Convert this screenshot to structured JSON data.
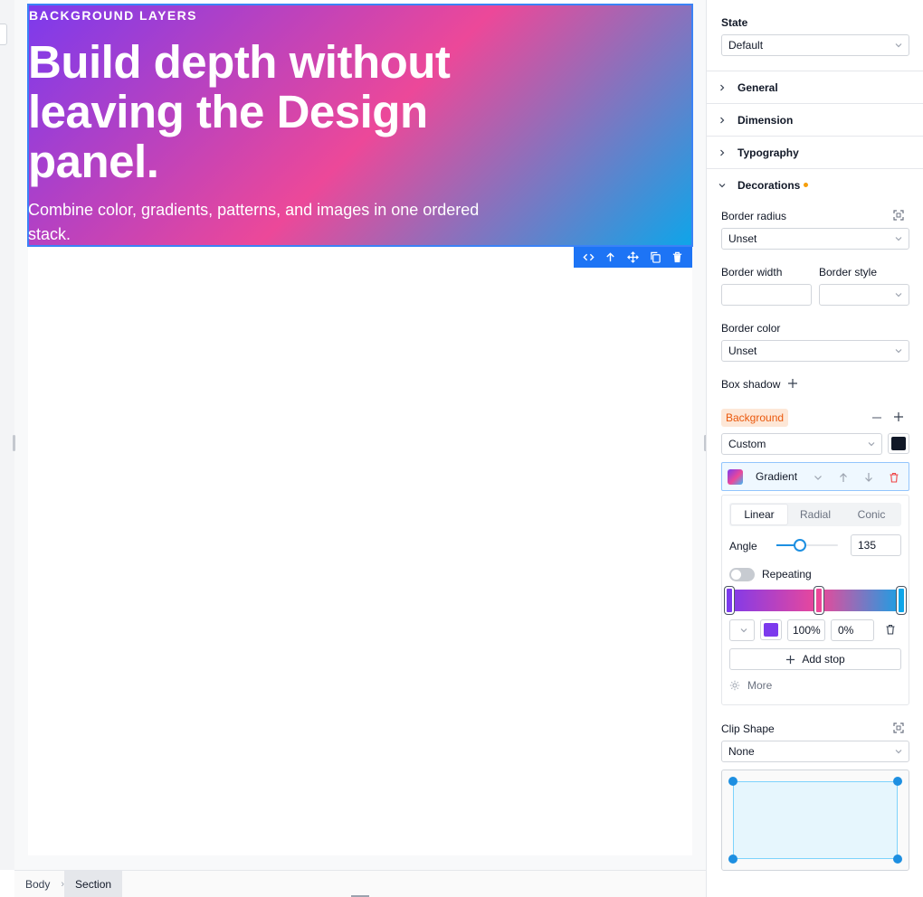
{
  "hero": {
    "eyebrow": "BACKGROUND LAYERS",
    "title": "Build depth without leaving the Design panel.",
    "subtitle": "Combine color, gradients, patterns, and images in one ordered stack.",
    "gradient_colors": [
      "#7c3aed",
      "#ec4899",
      "#0ea5e9"
    ]
  },
  "element_toolbar": {
    "icons": [
      "code-icon",
      "arrow-up-icon",
      "move-icon",
      "copy-icon",
      "trash-icon"
    ],
    "color": "#1d74f5"
  },
  "breadcrumb": {
    "items": [
      "Body",
      "Section"
    ],
    "active": "Section"
  },
  "panel": {
    "state": {
      "label": "State",
      "value": "Default"
    },
    "sections": {
      "general": "General",
      "dimension": "Dimension",
      "typography": "Typography",
      "decorations": "Decorations"
    },
    "border_radius": {
      "label": "Border radius",
      "value": "Unset"
    },
    "border_width": {
      "label": "Border width",
      "value": ""
    },
    "border_style": {
      "label": "Border style",
      "value": ""
    },
    "border_color": {
      "label": "Border color",
      "value": "Unset"
    },
    "box_shadow": {
      "label": "Box shadow"
    },
    "background": {
      "label": "Background",
      "mode": "Custom",
      "swatch_color": "#111827",
      "layer": {
        "type": "Gradient",
        "tabs": [
          "Linear",
          "Radial",
          "Conic"
        ],
        "active_tab": "Linear",
        "angle_label": "Angle",
        "angle_value": "135",
        "angle_fraction": 0.375,
        "repeating_label": "Repeating",
        "repeating": false,
        "stops": [
          {
            "color": "#7c3aed",
            "position": 0
          },
          {
            "color": "#ec4899",
            "position": 0.52
          },
          {
            "color": "#0ea5e9",
            "position": 1
          }
        ],
        "selected_stop": {
          "color": "#7c3aed",
          "opacity": "100%",
          "position": "0%"
        },
        "add_stop_label": "Add stop",
        "more_label": "More"
      }
    },
    "clip_shape": {
      "label": "Clip Shape",
      "value": "None"
    }
  }
}
